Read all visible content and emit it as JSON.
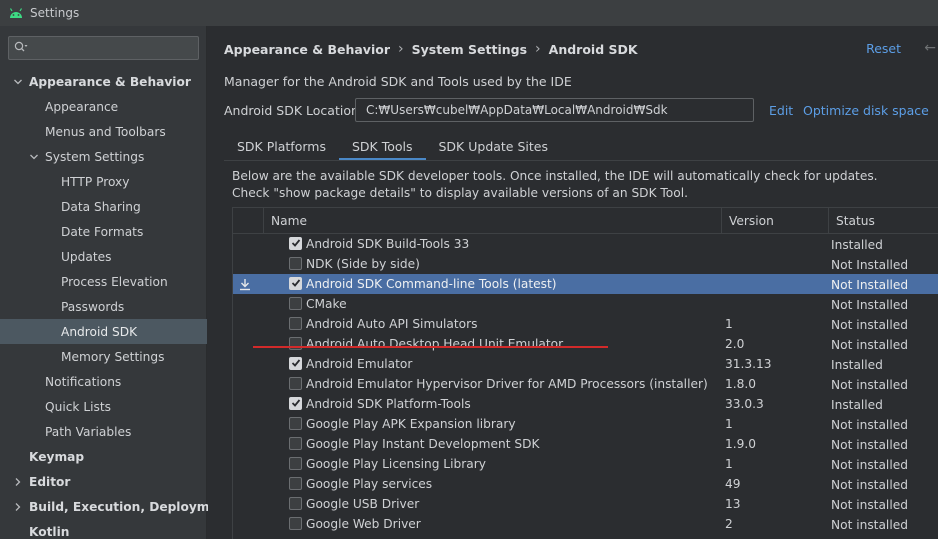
{
  "window": {
    "title": "Settings"
  },
  "sidebar": {
    "search_placeholder": "",
    "items": [
      {
        "label": "Appearance & Behavior",
        "level": 0,
        "bold": true,
        "expanded": true,
        "selected": false
      },
      {
        "label": "Appearance",
        "level": 1,
        "bold": false,
        "selected": false
      },
      {
        "label": "Menus and Toolbars",
        "level": 1,
        "bold": false,
        "selected": false
      },
      {
        "label": "System Settings",
        "level": 1,
        "bold": false,
        "expanded": true,
        "selected": false
      },
      {
        "label": "HTTP Proxy",
        "level": 2,
        "bold": false,
        "selected": false
      },
      {
        "label": "Data Sharing",
        "level": 2,
        "bold": false,
        "selected": false
      },
      {
        "label": "Date Formats",
        "level": 2,
        "bold": false,
        "selected": false
      },
      {
        "label": "Updates",
        "level": 2,
        "bold": false,
        "selected": false
      },
      {
        "label": "Process Elevation",
        "level": 2,
        "bold": false,
        "selected": false
      },
      {
        "label": "Passwords",
        "level": 2,
        "bold": false,
        "selected": false
      },
      {
        "label": "Android SDK",
        "level": 2,
        "bold": false,
        "selected": true
      },
      {
        "label": "Memory Settings",
        "level": 2,
        "bold": false,
        "selected": false
      },
      {
        "label": "Notifications",
        "level": 1,
        "bold": false,
        "selected": false
      },
      {
        "label": "Quick Lists",
        "level": 1,
        "bold": false,
        "selected": false
      },
      {
        "label": "Path Variables",
        "level": 1,
        "bold": false,
        "selected": false
      },
      {
        "label": "Keymap",
        "level": 0,
        "bold": true,
        "selected": false
      },
      {
        "label": "Editor",
        "level": 0,
        "bold": true,
        "collapsed": true,
        "selected": false
      },
      {
        "label": "Build, Execution, Deployment",
        "level": 0,
        "bold": true,
        "collapsed": true,
        "selected": false
      },
      {
        "label": "Kotlin",
        "level": 0,
        "bold": true,
        "selected": false
      }
    ]
  },
  "breadcrumb": [
    "Appearance & Behavior",
    "System Settings",
    "Android SDK"
  ],
  "reset_label": "Reset",
  "description": "Manager for the Android SDK and Tools used by the IDE",
  "sdk_location": {
    "label": "Android SDK Location:",
    "value": "C:₩Users₩cubel₩AppData₩Local₩Android₩Sdk",
    "edit_label": "Edit",
    "optimize_label": "Optimize disk space"
  },
  "tabs": [
    {
      "label": "SDK Platforms",
      "active": false
    },
    {
      "label": "SDK Tools",
      "active": true
    },
    {
      "label": "SDK Update Sites",
      "active": false
    }
  ],
  "info_line1": "Below are the available SDK developer tools. Once installed, the IDE will automatically check for updates.",
  "info_line2": "Check \"show package details\" to display available versions of an SDK Tool.",
  "table": {
    "headers": {
      "name": "Name",
      "version": "Version",
      "status": "Status"
    },
    "rows": [
      {
        "name": "Android SDK Build-Tools 33",
        "version": "",
        "status": "Installed",
        "checked": true,
        "selected": false,
        "download": false
      },
      {
        "name": "NDK (Side by side)",
        "version": "",
        "status": "Not Installed",
        "checked": false,
        "selected": false,
        "download": false
      },
      {
        "name": "Android SDK Command-line Tools (latest)",
        "version": "",
        "status": "Not Installed",
        "checked": true,
        "selected": true,
        "download": true
      },
      {
        "name": "CMake",
        "version": "",
        "status": "Not Installed",
        "checked": false,
        "selected": false,
        "download": false
      },
      {
        "name": "Android Auto API Simulators",
        "version": "1",
        "status": "Not installed",
        "checked": false,
        "selected": false,
        "download": false
      },
      {
        "name": "Android Auto Desktop Head Unit Emulator",
        "version": "2.0",
        "status": "Not installed",
        "checked": false,
        "selected": false,
        "download": false
      },
      {
        "name": "Android Emulator",
        "version": "31.3.13",
        "status": "Installed",
        "checked": true,
        "selected": false,
        "download": false
      },
      {
        "name": "Android Emulator Hypervisor Driver for AMD Processors (installer)",
        "version": "1.8.0",
        "status": "Not installed",
        "checked": false,
        "selected": false,
        "download": false
      },
      {
        "name": "Android SDK Platform-Tools",
        "version": "33.0.3",
        "status": "Installed",
        "checked": true,
        "selected": false,
        "download": false
      },
      {
        "name": "Google Play APK Expansion library",
        "version": "1",
        "status": "Not installed",
        "checked": false,
        "selected": false,
        "download": false
      },
      {
        "name": "Google Play Instant Development SDK",
        "version": "1.9.0",
        "status": "Not installed",
        "checked": false,
        "selected": false,
        "download": false
      },
      {
        "name": "Google Play Licensing Library",
        "version": "1",
        "status": "Not installed",
        "checked": false,
        "selected": false,
        "download": false
      },
      {
        "name": "Google Play services",
        "version": "49",
        "status": "Not installed",
        "checked": false,
        "selected": false,
        "download": false
      },
      {
        "name": "Google USB Driver",
        "version": "13",
        "status": "Not installed",
        "checked": false,
        "selected": false,
        "download": false
      },
      {
        "name": "Google Web Driver",
        "version": "2",
        "status": "Not installed",
        "checked": false,
        "selected": false,
        "download": false
      }
    ]
  },
  "colors": {
    "accent": "#4a88c7",
    "link": "#5c9ee6",
    "selection": "#4a6ea3",
    "annotation": "#d22a2a"
  }
}
